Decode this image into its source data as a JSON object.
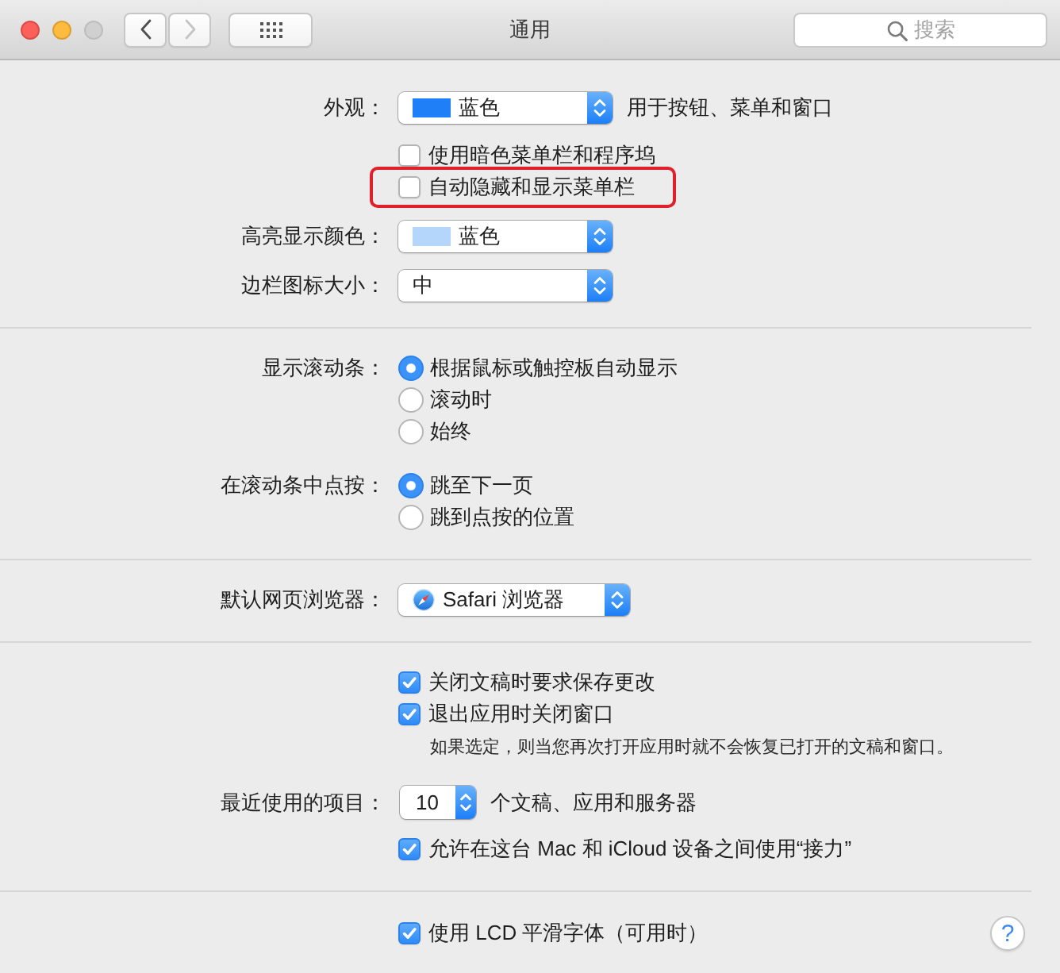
{
  "window": {
    "title": "通用",
    "controls": [
      {
        "kind": "close",
        "disabled": false
      },
      {
        "kind": "minimize",
        "disabled": false
      },
      {
        "kind": "zoom",
        "disabled": true
      }
    ]
  },
  "toolbar": {
    "navigation": [
      {
        "kind": "back",
        "disabled": false
      },
      {
        "kind": "forward",
        "disabled": true
      }
    ],
    "search": {
      "placeholder": "搜索"
    }
  },
  "sections": [
    {
      "rows": [
        {
          "kind": "field",
          "label": "外观：",
          "controls": [
            {
              "kind": "color_popup",
              "value": "蓝色",
              "color": "#1f7ff6"
            },
            {
              "kind": "text",
              "text": "用于按钮、菜单和窗口"
            }
          ]
        },
        {
          "kind": "checkbox",
          "text": "使用暗色菜单栏和程序坞",
          "checked": false,
          "highlighted": false
        },
        {
          "kind": "checkbox",
          "text": "自动隐藏和显示菜单栏",
          "checked": false,
          "highlighted": true
        },
        {
          "kind": "field",
          "label": "高亮显示颜色：",
          "controls": [
            {
              "kind": "color_popup",
              "value": "蓝色",
              "color": "#b4d6fb"
            }
          ]
        },
        {
          "kind": "field",
          "label": "边栏图标大小：",
          "controls": [
            {
              "kind": "popup",
              "value": "中"
            }
          ]
        }
      ]
    },
    {
      "rows": [
        {
          "kind": "radio_group",
          "label": "显示滚动条：",
          "options": [
            {
              "text": "根据鼠标或触控板自动显示",
              "selected": true
            },
            {
              "text": "滚动时",
              "selected": false
            },
            {
              "text": "始终",
              "selected": false
            }
          ]
        },
        {
          "kind": "radio_group",
          "label": "在滚动条中点按：",
          "options": [
            {
              "text": "跳至下一页",
              "selected": true
            },
            {
              "text": "跳到点按的位置",
              "selected": false
            }
          ]
        }
      ]
    },
    {
      "rows": [
        {
          "kind": "field",
          "label": "默认网页浏览器：",
          "controls": [
            {
              "kind": "app_popup",
              "value": "Safari 浏览器"
            }
          ]
        }
      ]
    },
    {
      "rows": [
        {
          "kind": "checkbox",
          "text": "关闭文稿时要求保存更改",
          "checked": true,
          "highlighted": false
        },
        {
          "kind": "checkbox",
          "text": "退出应用时关闭窗口",
          "checked": true,
          "highlighted": false
        },
        {
          "kind": "note",
          "text": "如果选定，则当您再次打开应用时就不会恢复已打开的文稿和窗口。"
        },
        {
          "kind": "field",
          "label": "最近使用的项目：",
          "controls": [
            {
              "kind": "stepper",
              "value": "10"
            },
            {
              "kind": "text",
              "text": "个文稿、应用和服务器"
            }
          ]
        },
        {
          "kind": "checkbox",
          "text": "允许在这台 Mac 和 iCloud 设备之间使用“接力”",
          "checked": true,
          "highlighted": false
        }
      ]
    },
    {
      "rows": [
        {
          "kind": "checkbox",
          "text": "使用 LCD 平滑字体（可用时）",
          "checked": true,
          "highlighted": false
        }
      ],
      "help_button": {
        "label": "?"
      }
    }
  ]
}
